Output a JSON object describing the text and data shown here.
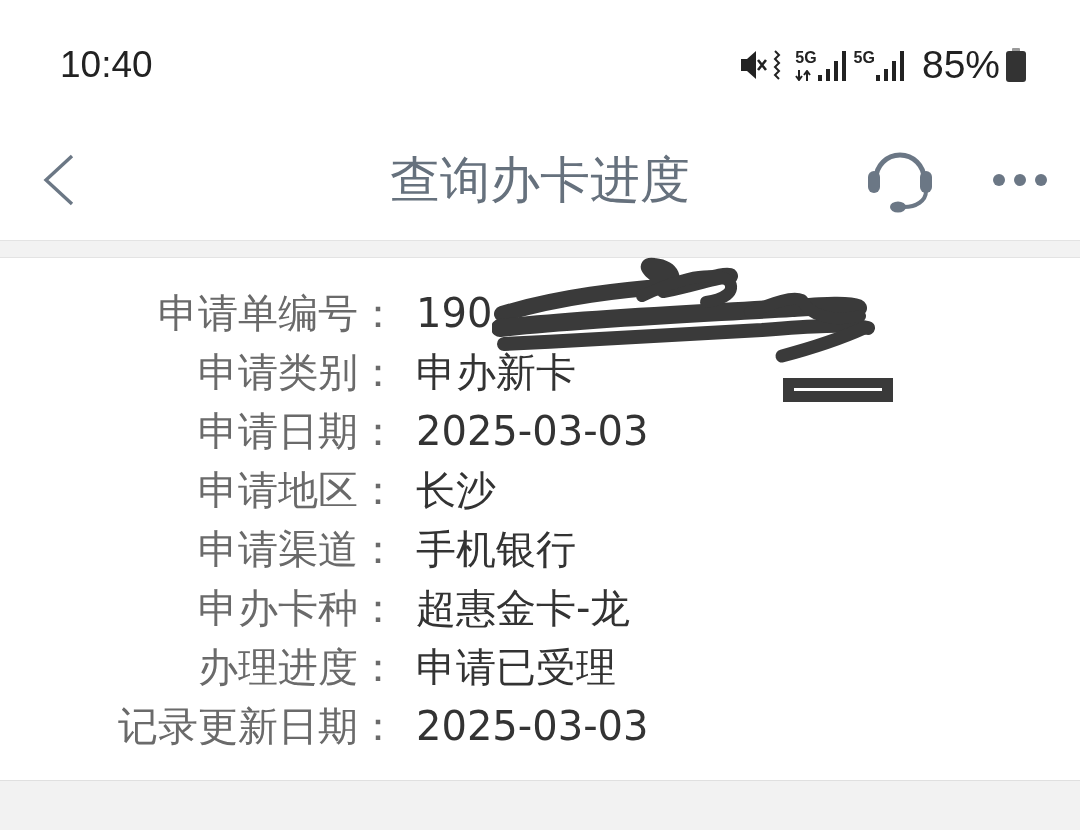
{
  "status_bar": {
    "time": "10:40",
    "networks": [
      {
        "label": "5G",
        "activity": true
      },
      {
        "label": "5G",
        "activity": false
      }
    ],
    "battery": "85%"
  },
  "title_bar": {
    "title": "查询办卡进度"
  },
  "details": [
    {
      "label": "申请单编号：",
      "value": "190",
      "redacted": true
    },
    {
      "label": "申请类别：",
      "value": "申办新卡",
      "redacted": false
    },
    {
      "label": "申请日期：",
      "value": "2025-03-03",
      "redacted": false
    },
    {
      "label": "申请地区：",
      "value": "长沙",
      "redacted": false
    },
    {
      "label": "申请渠道：",
      "value": "手机银行",
      "redacted": false
    },
    {
      "label": "申办卡种：",
      "value": "超惠金卡-龙",
      "redacted": false
    },
    {
      "label": "办理进度：",
      "value": "申请已受理",
      "redacted": false
    },
    {
      "label": "记录更新日期：",
      "value": "2025-03-03",
      "redacted": false
    }
  ]
}
